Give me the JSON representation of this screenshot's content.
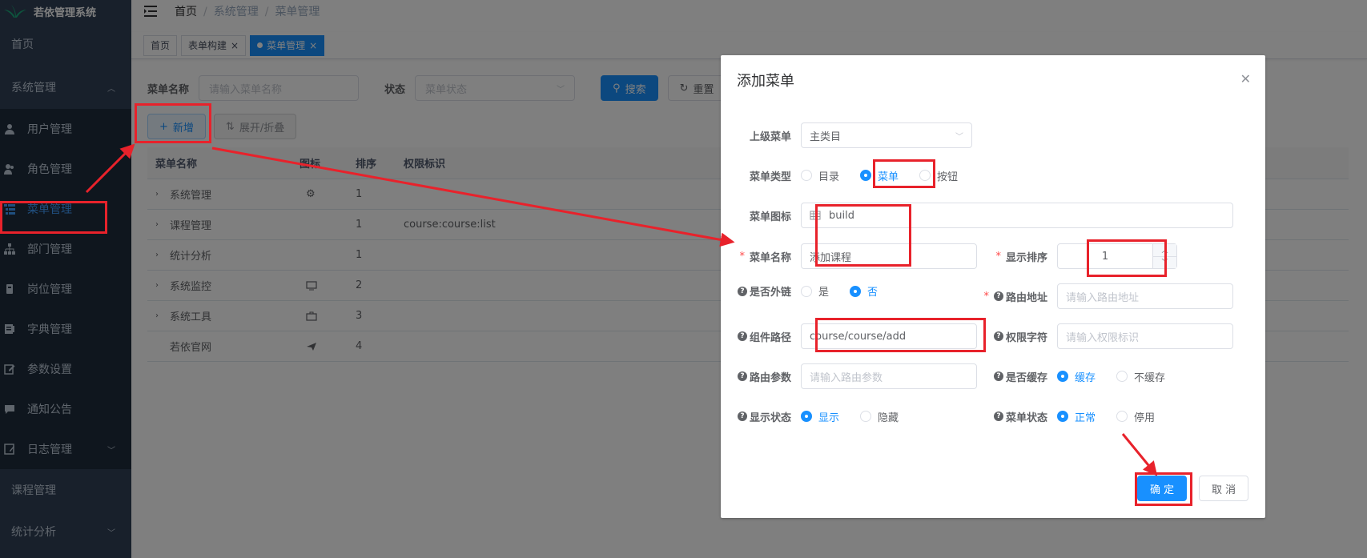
{
  "app": {
    "title": "若依管理系统"
  },
  "sidebar": {
    "home": "首页",
    "system": "系统管理",
    "system_items": [
      {
        "label": "用户管理",
        "icon": "user-icon"
      },
      {
        "label": "角色管理",
        "icon": "peoples-icon"
      },
      {
        "label": "菜单管理",
        "icon": "tree-table-icon"
      },
      {
        "label": "部门管理",
        "icon": "tree-icon"
      },
      {
        "label": "岗位管理",
        "icon": "post-icon"
      },
      {
        "label": "字典管理",
        "icon": "dict-icon"
      },
      {
        "label": "参数设置",
        "icon": "edit-icon"
      },
      {
        "label": "通知公告",
        "icon": "message-icon"
      },
      {
        "label": "日志管理",
        "icon": "log-icon"
      }
    ],
    "course": "课程管理",
    "stats": "统计分析"
  },
  "breadcrumb": {
    "home": "首页",
    "level1": "系统管理",
    "level2": "菜单管理",
    "sep": "/"
  },
  "tags": {
    "home": "首页",
    "form_build": "表单构建",
    "menu_mgmt": "菜单管理"
  },
  "query": {
    "name_label": "菜单名称",
    "name_placeholder": "请输入菜单名称",
    "status_label": "状态",
    "status_placeholder": "菜单状态",
    "search": "搜索",
    "reset": "重置"
  },
  "toolbar": {
    "add": "新增",
    "expand": "展开/折叠"
  },
  "table": {
    "headers": [
      "菜单名称",
      "图标",
      "排序",
      "权限标识"
    ],
    "rows": [
      {
        "name": "系统管理",
        "icon": "gear-icon",
        "order": "1",
        "perm": ""
      },
      {
        "name": "课程管理",
        "icon": "",
        "order": "1",
        "perm": "course:course:list"
      },
      {
        "name": "统计分析",
        "icon": "",
        "order": "1",
        "perm": ""
      },
      {
        "name": "系统监控",
        "icon": "monitor-icon",
        "order": "2",
        "perm": ""
      },
      {
        "name": "系统工具",
        "icon": "tool-icon",
        "order": "3",
        "perm": ""
      },
      {
        "name": "若依官网",
        "icon": "guide-icon",
        "order": "4",
        "perm": ""
      }
    ]
  },
  "dialog": {
    "title": "添加菜单",
    "parent_label": "上级菜单",
    "parent_value": "主类目",
    "type_label": "菜单类型",
    "type_options": [
      "目录",
      "菜单",
      "按钮"
    ],
    "type_selected": "菜单",
    "icon_label": "菜单图标",
    "icon_value": "build",
    "name_label": "菜单名称",
    "name_value": "添加课程",
    "order_label": "显示排序",
    "order_value": "1",
    "external_label": "是否外链",
    "external_options": [
      "是",
      "否"
    ],
    "external_selected": "否",
    "route_label": "路由地址",
    "route_placeholder": "请输入路由地址",
    "component_label": "组件路径",
    "component_value": "course/course/add",
    "perms_label": "权限字符",
    "perms_placeholder": "请输入权限标识",
    "query_label": "路由参数",
    "query_placeholder": "请输入路由参数",
    "cache_label": "是否缓存",
    "cache_options": [
      "缓存",
      "不缓存"
    ],
    "cache_selected": "缓存",
    "visible_label": "显示状态",
    "visible_options": [
      "显示",
      "隐藏"
    ],
    "visible_selected": "显示",
    "status_label": "菜单状态",
    "status_options": [
      "正常",
      "停用"
    ],
    "status_selected": "正常",
    "confirm": "确 定",
    "cancel": "取 消"
  },
  "colors": {
    "primary": "#1890ff",
    "sidebar_bg": "#304156",
    "annotation_red": "#e8222b"
  }
}
